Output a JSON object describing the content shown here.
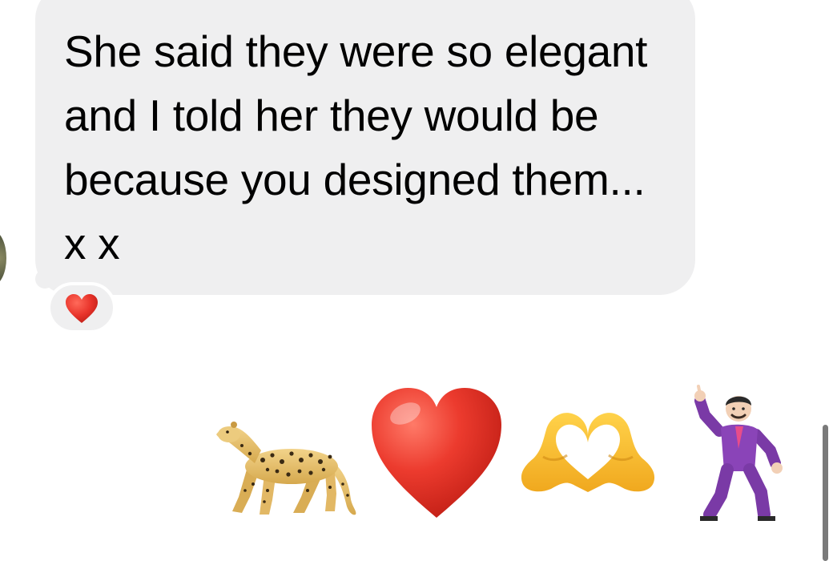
{
  "conversation": {
    "received_message": {
      "text": "She said they were so elegant and I told her they would be because you designed them... x x",
      "reaction": "red-heart"
    },
    "sent_message": {
      "emojis": [
        "leopard",
        "red-heart",
        "heart-hands",
        "man-dancing"
      ]
    }
  },
  "colors": {
    "bubble_background": "#efeff0",
    "text": "#000000",
    "heart": "#e8332a"
  }
}
